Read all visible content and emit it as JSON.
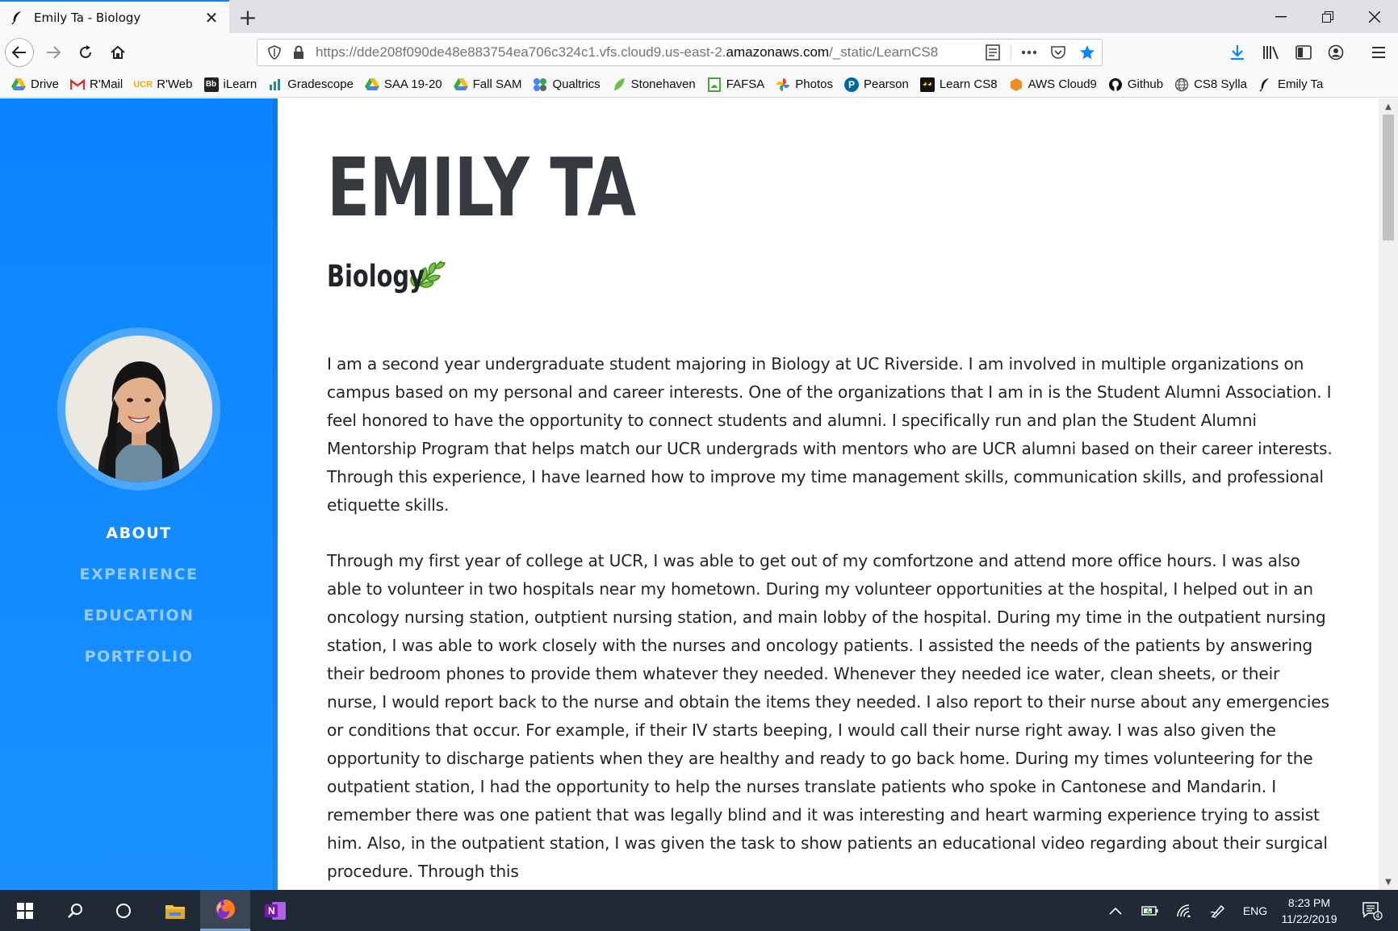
{
  "browser": {
    "tab": {
      "title": "Emily Ta - Biology"
    },
    "url": {
      "prefix": "https://dde208f090de48e883754ea706c324c1.vfs.cloud9.us-east-2.",
      "domain": "amazonaws.com",
      "suffix": "/_static/LearnCS8"
    },
    "bookmarks": [
      {
        "label": "Drive",
        "icon": "google-drive-icon"
      },
      {
        "label": "R'Mail",
        "icon": "gmail-icon"
      },
      {
        "label": "R'Web",
        "icon": "ucr-icon"
      },
      {
        "label": "iLearn",
        "icon": "blackboard-icon"
      },
      {
        "label": "Gradescope",
        "icon": "gradescope-icon"
      },
      {
        "label": "SAA 19-20",
        "icon": "google-drive-icon"
      },
      {
        "label": "Fall SAM",
        "icon": "google-drive-icon"
      },
      {
        "label": "Qualtrics",
        "icon": "qualtrics-icon"
      },
      {
        "label": "Stonehaven",
        "icon": "leaf-icon"
      },
      {
        "label": "FAFSA",
        "icon": "fafsa-icon"
      },
      {
        "label": "Photos",
        "icon": "google-photos-icon"
      },
      {
        "label": "Pearson",
        "icon": "pearson-icon"
      },
      {
        "label": "Learn CS8",
        "icon": "learncs8-icon"
      },
      {
        "label": "AWS Cloud9",
        "icon": "aws-cloud9-icon"
      },
      {
        "label": "Github",
        "icon": "github-icon"
      },
      {
        "label": "CS8 Sylla",
        "icon": "globe-icon"
      },
      {
        "label": "Emily Ta",
        "icon": "feather-icon"
      }
    ]
  },
  "sidebar": {
    "nav": [
      {
        "label": "ABOUT",
        "active": true
      },
      {
        "label": "EXPERIENCE",
        "active": false
      },
      {
        "label": "EDUCATION",
        "active": false
      },
      {
        "label": "PORTFOLIO",
        "active": false
      }
    ],
    "color": "#0a84ff"
  },
  "main": {
    "name": "EMILY TA",
    "subtitle": "Biology",
    "paragraphs": [
      "I am a second year undergraduate student majoring in Biology at UC Riverside. I am involved in multiple organizations on campus based on my personal and career interests. One of the organizations that I am in is the Student Alumni Association. I feel honored to have the opportunity to connect students and alumni. I specifically run and plan the Student Alumni Mentorship Program that helps match our UCR undergrads with mentors who are UCR alumni based on their career interests. Through this experience, I have learned how to improve my time management skills, communication skills, and professional etiquette skills.",
      "Through my first year of college at UCR, I was able to get out of my comfortzone and attend more office hours. I was also able to volunteer in two hospitals near my hometown. During my volunteer opportunities at the hospital, I helped out in an oncology nursing station, outptient nursing station, and main lobby of the hospital. During my time in the outpatient nursing station, I was able to work closely with the nurses and oncology patients. I assisted the needs of the patients by answering their bedroom phones to provide them whatever they needed. Whenever they needed ice water, clean sheets, or their nurse, I would report back to the nurse and obtain the items they needed. I also report to their nurse about any emergencies or conditions that occur. For example, if their IV starts beeping, I would call their nurse right away. I was also given the opportunity to discharge patients when they are healthy and ready to go back home. During my times volunteering for the outpatient station, I had the opportunity to help the nurses translate patients who spoke in Cantonese and Mandarin. I remember there was one patient that was legally blind and it was interesting and heart warming experience trying to assist him. Also, in the outpatient station, I was given the task to show patients an educational video regarding about their surgical procedure. Through this"
    ]
  },
  "taskbar": {
    "language": "ENG",
    "time": "8:23 PM",
    "date": "11/22/2019",
    "notifications": "4"
  }
}
